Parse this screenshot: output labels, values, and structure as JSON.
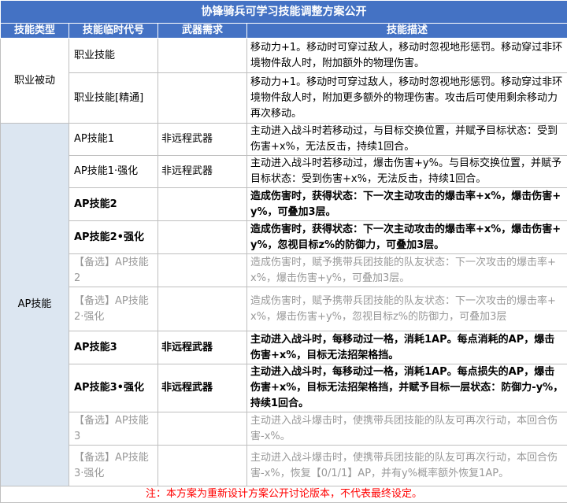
{
  "title": "协锋骑兵可学习技能调整方案公开",
  "headers": {
    "type": "技能类型",
    "code": "技能临时代号",
    "weapon": "武器需求",
    "desc": "技能描述"
  },
  "groups": {
    "passive": "职业被动",
    "ap": "AP技能"
  },
  "rows": [
    {
      "name": "职业技能",
      "weapon": "",
      "desc": "移动力+1。移动时可穿过敌人，移动时忽视地形惩罚。移动穿过非环境物件敌人时，附加额外的物理伤害。"
    },
    {
      "name": "职业技能[精通]",
      "weapon": "",
      "desc": "移动力+1。移动时可穿过敌人，移动时忽视地形惩罚。移动穿过非环境物件敌人时，附加更多额外的物理伤害。攻击后可使用剩余移动力再次移动。"
    },
    {
      "name": "AP技能1",
      "weapon": "非远程武器",
      "desc": "主动进入战斗时若移动过，与目标交换位置，并赋予目标状态：受到伤害+x%，无法反击，持续1回合。"
    },
    {
      "name": "AP技能1·强化",
      "weapon": "非远程武器",
      "desc": "主动进入战斗时若移动过，爆击伤害+y%。与目标交换位置，并赋予目标状态：受到伤害+x%，无法反击，持续1回合。"
    },
    {
      "name": "AP技能2",
      "weapon": "",
      "desc": "造成伤害时，获得状态：下一次主动攻击的爆击率+x%，爆击伤害+y%，可叠加3层。"
    },
    {
      "name": "AP技能2•强化",
      "weapon": "",
      "desc": "造成伤害时，获得状态：下一次主动攻击的爆击率+x%，爆击伤害+y%，忽视目标z%的防御力，可叠加3层。"
    },
    {
      "name": "【备选】AP技能2",
      "weapon": "",
      "desc": "造成伤害时，赋予携带兵团技能的队友状态：下一次攻击的爆击率+x%，爆击伤害+y%，可叠加3层。"
    },
    {
      "name": "【备选】AP技能2·强化",
      "weapon": "",
      "desc": "造成伤害时，赋予携带兵团技能的队友状态：下一次攻击的爆击率+x%，爆击伤害+y%，忽视目标z%的防御力，可叠加3层"
    },
    {
      "name": "AP技能3",
      "weapon": "非远程武器",
      "desc": "主动进入战斗时，每移动过一格，消耗1AP。每点消耗的AP，爆击伤害+x%，目标无法招架格挡。"
    },
    {
      "name": "AP技能3•强化",
      "weapon": "非远程武器",
      "desc": "主动进入战斗时，每移动过一格，消耗1AP。每点损失的AP，爆击伤害+x%，目标无法招架格挡，并赋予目标一层状态：防御力-y%，持续1回合。"
    },
    {
      "name": "【备选】AP技能3",
      "weapon": "",
      "desc": "主动进入战斗爆击时，使携带兵团技能的队友可再次行动，本回合伤害-x%。"
    },
    {
      "name": "【备选】AP技能3·强化",
      "weapon": "",
      "desc": "主动进入战斗爆击时，使携带兵团技能的队友可再次行动，本回合伤害-x%，恢复【0/1/1】AP，并有y%概率额外恢复1AP。"
    }
  ],
  "footer": "注：本方案为重新设计方案公开讨论版本，不代表最终设定。",
  "colors": {
    "header_bg": "#4472c4",
    "ap_group_bg": "#dce6f1",
    "gray_text": "#999999",
    "footer_text": "#ff0000"
  }
}
